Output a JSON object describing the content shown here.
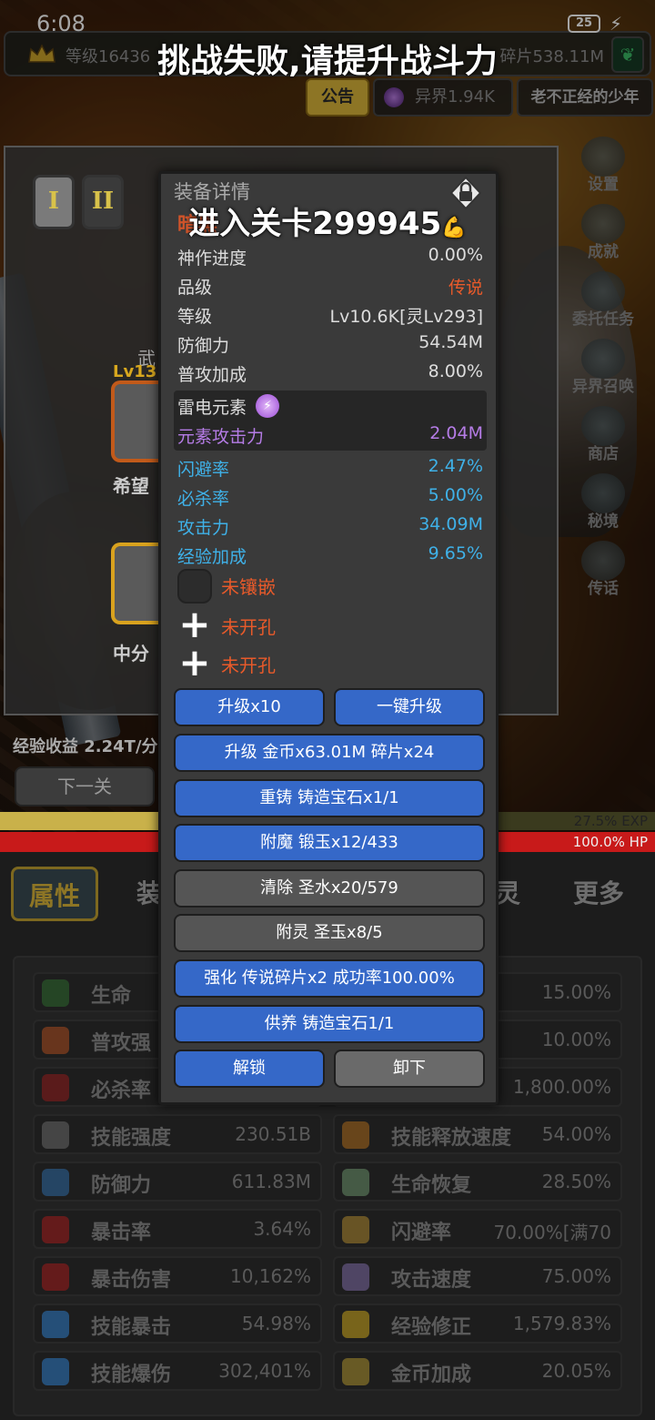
{
  "status": {
    "time": "6:08",
    "battery": "25"
  },
  "topbar": {
    "level": "等级16436",
    "fragments": "碎片538.11M"
  },
  "toasts": {
    "fail": "挑战失败,请提升战斗力",
    "enter": "进入关卡299945"
  },
  "header": {
    "notice": "公告",
    "otherworld": "异界1.94K",
    "player": "老不正经的少年"
  },
  "sidemenu": [
    "设置",
    "成就",
    "委托任务",
    "异界召唤",
    "商店",
    "秘境",
    "传话"
  ],
  "backpanel": {
    "tabs": [
      "I",
      "II"
    ],
    "weapon_label": "武",
    "item1": {
      "lv": "Lv13",
      "name": "希望"
    },
    "item2": {
      "name": "中分"
    },
    "exp_gain": "经验收益 2.24T/分",
    "next_button": "下一关"
  },
  "bars": {
    "exp": "27.5% EXP",
    "exp_fraction": 0.275,
    "hp": "100.0% HP",
    "hp_fraction": 1.0
  },
  "bottom_tabs": [
    "属性",
    "装",
    "灵",
    "更多"
  ],
  "stats": [
    {
      "name": "生命",
      "value": "",
      "color": "#3a6a3a"
    },
    {
      "name": "",
      "value": "15.00%",
      "color": "#555"
    },
    {
      "name": "普攻强",
      "value": "",
      "color": "#a0522d"
    },
    {
      "name": "",
      "value": "10.00%",
      "color": "#555"
    },
    {
      "name": "必杀率",
      "value": "",
      "color": "#8a2a2a"
    },
    {
      "name": "",
      "value": "1,800.00%",
      "color": "#555"
    },
    {
      "name": "技能强度",
      "value": "230.51B",
      "color": "#6a6a6a"
    },
    {
      "name": "技能释放速度",
      "value": "54.00%",
      "color": "#a06a2a"
    },
    {
      "name": "防御力",
      "value": "611.83M",
      "color": "#3a6a9a"
    },
    {
      "name": "生命恢复",
      "value": "28.50%",
      "color": "#6a8a6a"
    },
    {
      "name": "暴击率",
      "value": "3.64%",
      "color": "#9a2a2a"
    },
    {
      "name": "闪避率",
      "value": "70.00%[满70",
      "color": "#a0823a"
    },
    {
      "name": "暴击伤害",
      "value": "10,162%",
      "color": "#9a2a2a"
    },
    {
      "name": "攻击速度",
      "value": "75.00%",
      "color": "#7a6a9a"
    },
    {
      "name": "技能暴击",
      "value": "54.98%",
      "color": "#3a7ab8"
    },
    {
      "name": "经验修正",
      "value": "1,579.83%",
      "color": "#b89a2a"
    },
    {
      "name": "技能爆伤",
      "value": "302,401%",
      "color": "#3a7ab8"
    },
    {
      "name": "金币加成",
      "value": "20.05%",
      "color": "#a08a3a"
    }
  ],
  "modal": {
    "title": "装备详情",
    "item_name": "暗黑",
    "rows": [
      {
        "k": "神作进度",
        "v": "0.00%"
      },
      {
        "k": "品级",
        "v": "传说"
      },
      {
        "k": "等级",
        "v": "Lv10.6K[灵Lv293]"
      },
      {
        "k": "防御力",
        "v": "54.54M"
      },
      {
        "k": "普攻加成",
        "v": "8.00%"
      }
    ],
    "element": {
      "name": "雷电元素",
      "k": "元素攻击力",
      "v": "2.04M"
    },
    "blue_rows": [
      {
        "k": "闪避率",
        "v": "2.47%"
      },
      {
        "k": "必杀率",
        "v": "5.00%"
      },
      {
        "k": "攻击力",
        "v": "34.09M"
      },
      {
        "k": "经验加成",
        "v": "9.65%"
      }
    ],
    "sockets": [
      "未镶嵌",
      "未开孔",
      "未开孔"
    ],
    "buttons": {
      "upgrade10": "升级x10",
      "upgrade_all": "一键升级",
      "upgrade": "升级 金币x63.01M 碎片x24",
      "reforge": "重铸 铸造宝石x1/1",
      "enchant": "附魔 锻玉x12/433",
      "clear": "清除 圣水x20/579",
      "spirit": "附灵 圣玉x8/5",
      "strengthen": "强化 传说碎片x2 成功率100.00%",
      "nurture": "供养 铸造宝石1/1",
      "unlock": "解锁",
      "unequip": "卸下"
    }
  }
}
